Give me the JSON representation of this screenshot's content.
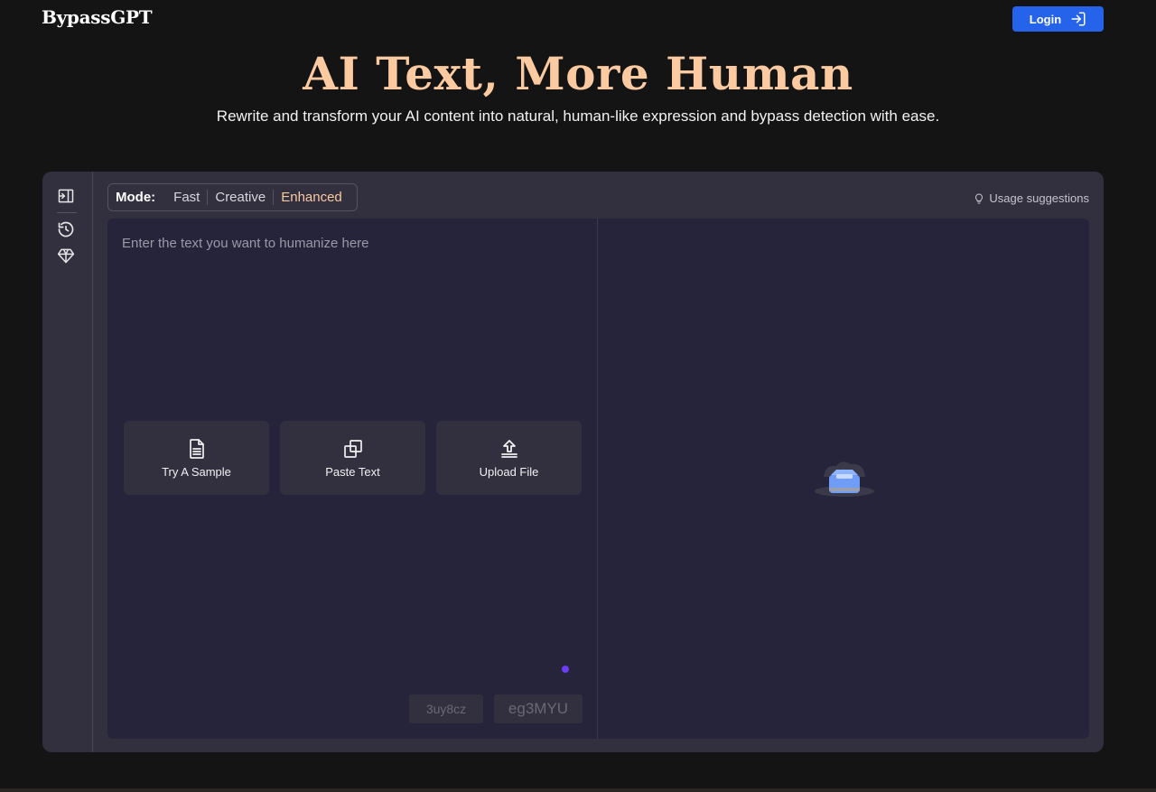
{
  "brand": {
    "name": "BypassGPT"
  },
  "header": {
    "login_label": "Login"
  },
  "hero": {
    "title": "AI Text, More Human",
    "subtitle": "Rewrite and transform your AI content into natural, human-like expression and bypass detection with ease."
  },
  "sidebar": {
    "items": [
      {
        "icon": "collapse-panel-icon"
      },
      {
        "icon": "history-icon"
      },
      {
        "icon": "diamond-icon"
      }
    ]
  },
  "mode": {
    "label": "Mode:",
    "options": [
      "Fast",
      "Creative",
      "Enhanced"
    ],
    "selected": "Enhanced"
  },
  "usage_link": "Usage suggestions",
  "input": {
    "placeholder": "Enter the text you want to humanize here"
  },
  "actions": [
    {
      "label": "Try A Sample",
      "icon": "document-icon"
    },
    {
      "label": "Paste Text",
      "icon": "copy-icon"
    },
    {
      "label": "Upload File",
      "icon": "upload-icon"
    }
  ],
  "chips": [
    "3uy8cz",
    "eg3MYU"
  ],
  "colors": {
    "background": "#141414",
    "accent": "#2563eb",
    "title": "#fbcaa0",
    "panel": "#32303f",
    "editor": "#25243a",
    "dot": "#6d3df5"
  }
}
